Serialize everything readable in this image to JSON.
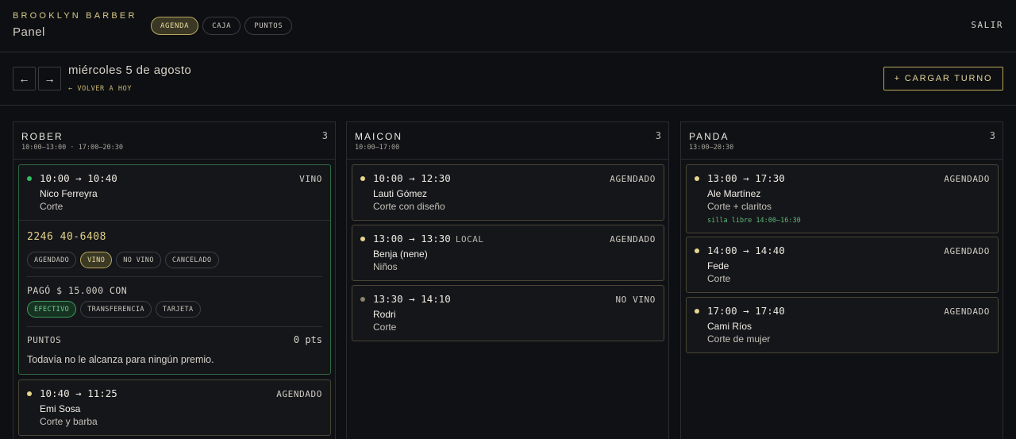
{
  "header": {
    "brand": "BROOKLYN BARBER",
    "subtitle": "Panel",
    "tabs": [
      "AGENDA",
      "CAJA",
      "PUNTOS"
    ],
    "logout": "SALIR"
  },
  "datebar": {
    "prev": "←",
    "next": "→",
    "date": "miércoles 5 de agosto",
    "today": "← VOLVER A HOY",
    "add": "+ CARGAR TURNO"
  },
  "colors": {
    "accent": "#d9c98a",
    "green": "#2fbf5f",
    "gold_dot": "#e6d58c",
    "grey_dot": "#8a836a"
  },
  "barbers": [
    {
      "name": "ROBER",
      "hours": "10:00–13:00 · 17:00–20:30",
      "count": "3",
      "appointments": [
        {
          "time": "10:00 → 10:40",
          "status": "VINO",
          "client": "Nico Ferreyra",
          "service": "Corte"
        },
        {
          "time": "10:40 → 11:25",
          "status": "AGENDADO",
          "client": "Emi Sosa",
          "service": "Corte y barba"
        }
      ],
      "detail": {
        "phone": "2246 40-6408",
        "status_options": [
          "AGENDADO",
          "VINO",
          "NO VINO",
          "CANCELADO"
        ],
        "paid": "PAGÓ $ 15.000 CON",
        "pay_options": [
          "EFECTIVO",
          "TRANSFERENCIA",
          "TARJETA"
        ],
        "points_label": "PUNTOS",
        "points_value": "0 pts",
        "points_msg": "Todavía no le alcanza para ningún premio."
      }
    },
    {
      "name": "MAICON",
      "hours": "10:00–17:00",
      "count": "3",
      "appointments": [
        {
          "time": "10:00 → 12:30",
          "tag": "",
          "status": "AGENDADO",
          "client": "Lauti Gómez",
          "service": "Corte con diseño"
        },
        {
          "time": "13:00 → 13:30",
          "tag": "LOCAL",
          "status": "AGENDADO",
          "client": "Benja (nene)",
          "service": "Niños"
        },
        {
          "time": "13:30 → 14:10",
          "tag": "",
          "status": "NO VINO",
          "client": "Rodri",
          "service": "Corte"
        }
      ]
    },
    {
      "name": "PANDA",
      "hours": "13:00–20:30",
      "count": "3",
      "appointments": [
        {
          "time": "13:00 → 17:30",
          "status": "AGENDADO",
          "client": "Ale Martínez",
          "service": "Corte + claritos",
          "note": "silla libre 14:00–16:30"
        },
        {
          "time": "14:00 → 14:40",
          "status": "AGENDADO",
          "client": "Fede",
          "service": "Corte"
        },
        {
          "time": "17:00 → 17:40",
          "status": "AGENDADO",
          "client": "Cami Ríos",
          "service": "Corte de mujer"
        }
      ]
    }
  ]
}
